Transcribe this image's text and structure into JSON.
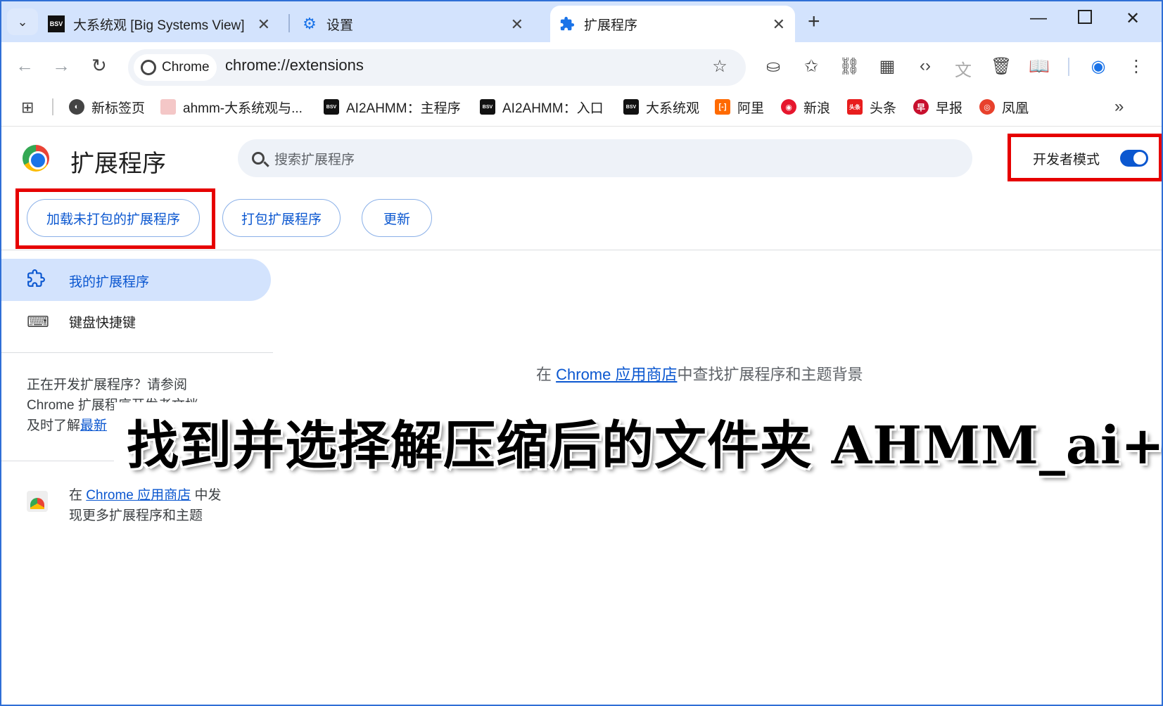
{
  "tabs": [
    {
      "title": "大系统观 [Big Systems View]",
      "icon": "bsv-icon"
    },
    {
      "title": "设置",
      "icon": "gear-icon"
    },
    {
      "title": "扩展程序",
      "icon": "puzzle-icon",
      "active": true
    }
  ],
  "toolbar": {
    "chip_label": "Chrome",
    "url": "chrome://extensions"
  },
  "bookmarks": [
    {
      "label": "新标签页",
      "icon": "globe-icon"
    },
    {
      "label": "ahmm-大系统观与...",
      "icon": "bookmark-favicon"
    },
    {
      "label": "AI2AHMM：主程序",
      "icon": "bsv-icon"
    },
    {
      "label": "AI2AHMM：入口",
      "icon": "bsv-icon"
    },
    {
      "label": "大系统观",
      "icon": "bsv-icon"
    },
    {
      "label": "阿里",
      "icon": "ali-icon"
    },
    {
      "label": "新浪",
      "icon": "weibo-icon"
    },
    {
      "label": "头条",
      "icon": "toutiao-icon"
    },
    {
      "label": "早报",
      "icon": "zaobao-icon"
    },
    {
      "label": "凤凰",
      "icon": "ifeng-icon"
    }
  ],
  "page": {
    "title": "扩展程序",
    "search_placeholder": "搜索扩展程序",
    "dev_mode_label": "开发者模式",
    "dev_mode_on": true,
    "buttons": {
      "load_unpacked": "加载未打包的扩展程序",
      "pack": "打包扩展程序",
      "update": "更新"
    },
    "nav": {
      "my_extensions": "我的扩展程序",
      "shortcuts": "键盘快捷键"
    },
    "dev_note": {
      "line1": "正在开发扩展程序？请参阅",
      "line2": "Chrome 扩展程序开发者文档",
      "line3_prefix": "及时了解",
      "line3_link": "最新"
    },
    "store_promo": {
      "prefix": "在",
      "link": "Chrome 应用商店",
      "suffix": "中发",
      "line2": "现更多扩展程序和主题"
    },
    "center_msg": {
      "prefix": "在 ",
      "link": "Chrome 应用商店",
      "suffix": "中查找扩展程序和主题背景"
    }
  },
  "overlay_caption": "找到并选择解压缩后的文件夹 AHMM_ai+",
  "colors": {
    "highlight_box": "#e60000",
    "accent": "#0b57d0",
    "tabstrip": "#d3e3fd"
  }
}
